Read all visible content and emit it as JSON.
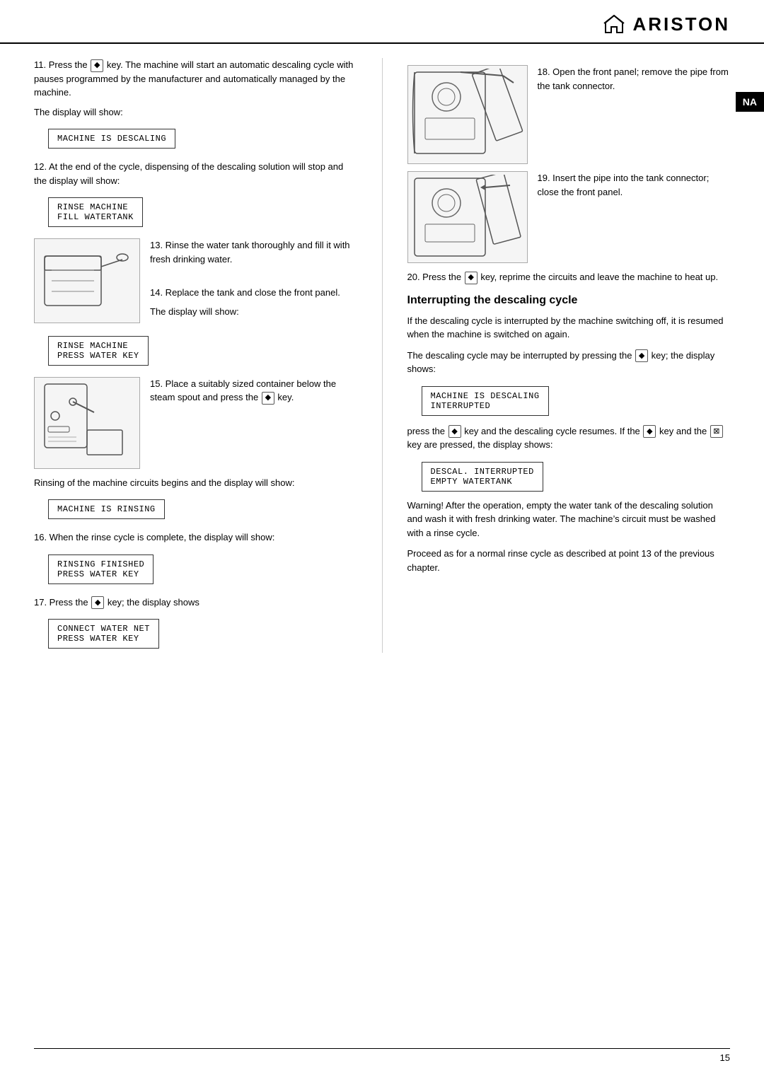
{
  "header": {
    "logo_text": "ARISTON"
  },
  "na_label": "NA",
  "page_number": "15",
  "left_column": {
    "intro_text": "11. Press the ⧆ key. The machine will start an automatic descaling cycle with pauses programmed by the manufacturer and automatically managed by the machine.",
    "display_show_label": "The display will show:",
    "display1": "MACHINE IS DESCALING",
    "step12_text": "12. At the end of the cycle, dispensing of the descaling solution will stop and the display will show:",
    "display2_line1": "RINSE MACHINE",
    "display2_line2": "FILL WATERTANK",
    "step13_text": "13. Rinse the water tank thoroughly and fill it with fresh drinking water.",
    "step14_text": "14. Replace the tank and close the front panel.",
    "display_show_label2": "The display will show:",
    "display3_line1": "RINSE MACHINE",
    "display3_line2": "PRESS WATER KEY",
    "step15_text": "15. Place a suitably sized container below the steam spout and press the ⧆ key.",
    "rinsing_text": "Rinsing of the machine circuits begins and the display will show:",
    "display4": "MACHINE IS RINSING",
    "step16_text": "16. When the rinse cycle is complete, the display will show:",
    "display5_line1": "RINSING FINISHED",
    "display5_line2": "PRESS WATER KEY",
    "step17_text": "17. Press the ⧆ key; the display shows",
    "display6_line1": "CONNECT WATER NET",
    "display6_line2": "PRESS WATER KEY"
  },
  "right_column": {
    "step18_text": "18. Open the front panel; remove the pipe from the tank connector.",
    "step19_text": "19. Insert the pipe into the tank connector; close the front panel.",
    "step20_text": "20. Press the ⧆ key, reprime the circuits and leave the machine to heat up.",
    "section_title": "Interrupting the descaling cycle",
    "interrupt_p1": "If the descaling cycle is interrupted by the machine switching off, it is resumed when the machine is switched on again.",
    "interrupt_p2": "The descaling cycle may be interrupted by pressing the ⧆ key; the display shows:",
    "display7_line1": "MACHINE IS DESCALING",
    "display7_line2": "INTERRUPTED",
    "interrupt_p3": "press the ⧆ key and the descaling cycle resumes. If the ⧆ key and the ⊞ key are pressed, the display shows:",
    "display8_line1": "DESCAL. INTERRUPTED",
    "display8_line2": "EMPTY WATERTANK",
    "warning_text": "Warning! After the operation, empty the water tank of the descaling solution and wash it with fresh drinking water. The machine’s circuit must be washed with a rinse cycle.",
    "proceed_text": "Proceed as for a normal rinse cycle as described at point 13 of the previous chapter."
  }
}
